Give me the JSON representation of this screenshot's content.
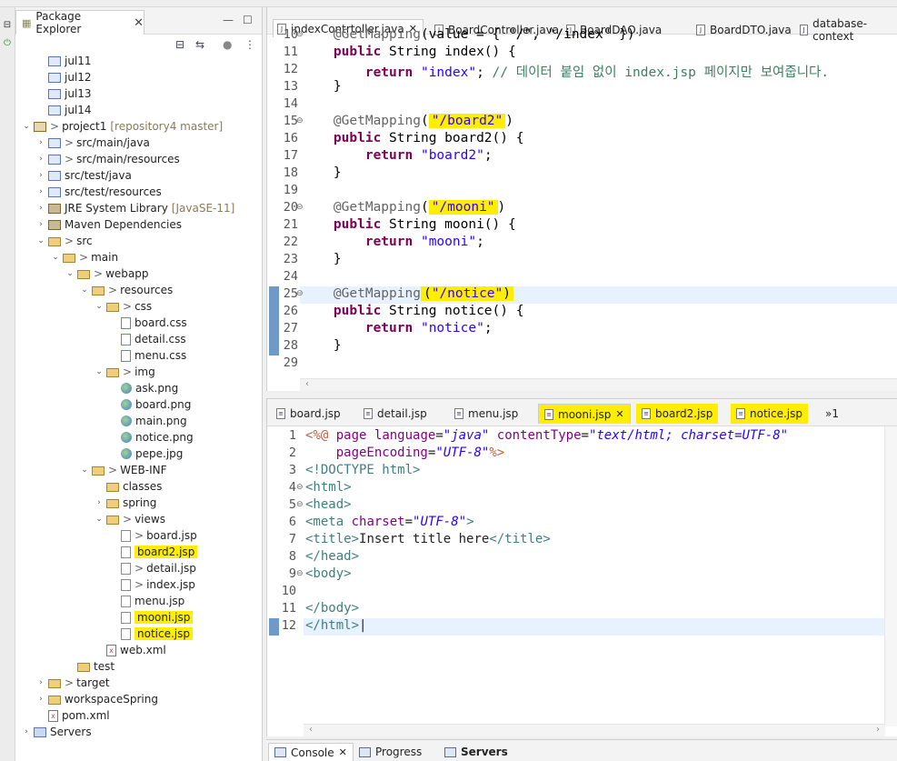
{
  "explorer": {
    "tab_label": "Package Explorer",
    "items": [
      {
        "label": "jul11",
        "indent": 1,
        "icon": "package-icon"
      },
      {
        "label": "jul12",
        "indent": 1,
        "icon": "package-icon"
      },
      {
        "label": "jul13",
        "indent": 1,
        "icon": "package-icon"
      },
      {
        "label": "jul14",
        "indent": 1,
        "icon": "package-icon"
      },
      {
        "label": "project1",
        "prefix": ">",
        "suffix": "[repository4 master]",
        "indent": 0,
        "twisty": "down",
        "icon": "project-icon"
      },
      {
        "label": "src/main/java",
        "prefix": ">",
        "indent": 1,
        "twisty": "right",
        "icon": "source-folder-icon"
      },
      {
        "label": "src/main/resources",
        "prefix": ">",
        "indent": 1,
        "twisty": "right",
        "icon": "source-folder-icon"
      },
      {
        "label": "src/test/java",
        "indent": 1,
        "twisty": "right",
        "icon": "source-folder-icon"
      },
      {
        "label": "src/test/resources",
        "indent": 1,
        "twisty": "right",
        "icon": "source-folder-icon"
      },
      {
        "label": "JRE System Library",
        "suffix": "[JavaSE-11]",
        "indent": 1,
        "twisty": "right",
        "icon": "library-icon"
      },
      {
        "label": "Maven Dependencies",
        "indent": 1,
        "twisty": "right",
        "icon": "library-icon"
      },
      {
        "label": "src",
        "prefix": ">",
        "indent": 1,
        "twisty": "down",
        "icon": "folder-icon"
      },
      {
        "label": "main",
        "prefix": ">",
        "indent": 2,
        "twisty": "down",
        "icon": "folder-icon"
      },
      {
        "label": "webapp",
        "prefix": ">",
        "indent": 3,
        "twisty": "down",
        "icon": "folder-icon"
      },
      {
        "label": "resources",
        "prefix": ">",
        "indent": 4,
        "twisty": "down",
        "icon": "folder-icon"
      },
      {
        "label": "css",
        "prefix": ">",
        "indent": 5,
        "twisty": "down",
        "icon": "folder-icon"
      },
      {
        "label": "board.css",
        "indent": 6,
        "icon": "css-file-icon"
      },
      {
        "label": "detail.css",
        "indent": 6,
        "icon": "css-file-icon"
      },
      {
        "label": "menu.css",
        "indent": 6,
        "icon": "css-file-icon"
      },
      {
        "label": "img",
        "prefix": ">",
        "indent": 5,
        "twisty": "down",
        "icon": "folder-icon"
      },
      {
        "label": "ask.png",
        "indent": 6,
        "icon": "image-file-icon"
      },
      {
        "label": "board.png",
        "indent": 6,
        "icon": "image-file-icon"
      },
      {
        "label": "main.png",
        "indent": 6,
        "icon": "image-file-icon"
      },
      {
        "label": "notice.png",
        "indent": 6,
        "icon": "image-file-icon"
      },
      {
        "label": "pepe.jpg",
        "indent": 6,
        "icon": "image-file-icon"
      },
      {
        "label": "WEB-INF",
        "prefix": ">",
        "indent": 4,
        "twisty": "down",
        "icon": "folder-icon"
      },
      {
        "label": "classes",
        "indent": 5,
        "icon": "folder-icon"
      },
      {
        "label": "spring",
        "indent": 5,
        "twisty": "right",
        "icon": "folder-icon"
      },
      {
        "label": "views",
        "prefix": ">",
        "indent": 5,
        "twisty": "down",
        "icon": "folder-icon"
      },
      {
        "label": "board.jsp",
        "prefix": ">",
        "indent": 6,
        "icon": "jsp-file-icon"
      },
      {
        "label": "board2.jsp",
        "indent": 6,
        "icon": "jsp-file-icon",
        "highlight": true
      },
      {
        "label": "detail.jsp",
        "prefix": ">",
        "indent": 6,
        "icon": "jsp-file-icon"
      },
      {
        "label": "index.jsp",
        "prefix": ">",
        "indent": 6,
        "icon": "jsp-file-icon"
      },
      {
        "label": "menu.jsp",
        "indent": 6,
        "icon": "jsp-file-icon"
      },
      {
        "label": "mooni.jsp",
        "indent": 6,
        "icon": "jsp-file-icon",
        "highlight": true
      },
      {
        "label": "notice.jsp",
        "indent": 6,
        "icon": "jsp-file-icon",
        "highlight": true
      },
      {
        "label": "web.xml",
        "indent": 5,
        "icon": "xml-file-icon"
      },
      {
        "label": "test",
        "indent": 3,
        "icon": "folder-icon"
      },
      {
        "label": "target",
        "prefix": ">",
        "indent": 1,
        "twisty": "right",
        "icon": "folder-icon"
      },
      {
        "label": "workspaceSpring",
        "indent": 1,
        "twisty": "right",
        "icon": "folder-icon"
      },
      {
        "label": "pom.xml",
        "indent": 1,
        "icon": "xml-file-icon"
      },
      {
        "label": "Servers",
        "indent": 0,
        "twisty": "right",
        "icon": "servers-folder-icon"
      }
    ]
  },
  "editor": {
    "tabs": [
      {
        "label": "indexContrtoller.java",
        "active": true
      },
      {
        "label": "BoardController.java"
      },
      {
        "label": "BoardDAO.java"
      },
      {
        "label": "BoardDTO.java"
      },
      {
        "label": "database-context"
      }
    ],
    "lines": [
      {
        "n": "10",
        "fold": true,
        "html": "    <span class='ann'>@GetMapping</span>(value = { \"/\", \"/index\" })"
      },
      {
        "n": "11",
        "html": "    <span class='kw'>public</span> String index() {"
      },
      {
        "n": "12",
        "html": "        <span class='kw'>return</span> <span class='str'>\"index\"</span>; <span class='cmt'>// 데이터 붙임 없이 index.jsp 페이지만 보여줍니다.</span>"
      },
      {
        "n": "13",
        "html": "    }"
      },
      {
        "n": "14",
        "html": ""
      },
      {
        "n": "15",
        "fold": true,
        "html": "    <span class='ann'>@GetMapping</span>(<span class='hl'><span class='str'>\"/board2\"</span></span>)"
      },
      {
        "n": "16",
        "html": "    <span class='kw'>public</span> String board2() {"
      },
      {
        "n": "17",
        "html": "        <span class='kw'>return</span> <span class='str'>\"board2\"</span>;"
      },
      {
        "n": "18",
        "html": "    }"
      },
      {
        "n": "19",
        "html": ""
      },
      {
        "n": "20",
        "fold": true,
        "html": "    <span class='ann'>@GetMapping</span>(<span class='hl'><span class='str'>\"/mooni\"</span></span>)"
      },
      {
        "n": "21",
        "html": "    <span class='kw'>public</span> String mooni() {"
      },
      {
        "n": "22",
        "html": "        <span class='kw'>return</span> <span class='str'>\"mooni\"</span>;"
      },
      {
        "n": "23",
        "html": "    }"
      },
      {
        "n": "24",
        "html": ""
      },
      {
        "n": "25",
        "fold": true,
        "mark": true,
        "cur": true,
        "html": "    <span class='ann'>@GetMapping</span><span class='hl'>(<span class='str'>\"/notice\"</span>)</span>"
      },
      {
        "n": "26",
        "mark": true,
        "html": "    <span class='kw'>public</span> String notice() {"
      },
      {
        "n": "27",
        "mark": true,
        "html": "        <span class='kw'>return</span> <span class='str'>\"notice\"</span>;"
      },
      {
        "n": "28",
        "mark": true,
        "html": "    }"
      },
      {
        "n": "29",
        "html": ""
      }
    ]
  },
  "jsp_editor": {
    "tabs": [
      {
        "label": "board.jsp"
      },
      {
        "label": "detail.jsp"
      },
      {
        "label": "menu.jsp"
      },
      {
        "label": "mooni.jsp",
        "active": true,
        "highlight": true
      },
      {
        "label": "board2.jsp",
        "highlight": true
      },
      {
        "label": "notice.jsp",
        "highlight": true
      }
    ],
    "overflow_label": "»1",
    "lines": [
      {
        "n": "1",
        "html": "<span class='jsp-dir'>&lt;%@</span> <span class='attr'>page</span> <span class='attr'>language</span>=<span class='aval'>\"java\"</span> <span class='attr'>contentType</span>=<span class='aval'>\"text/html; charset=UTF-8\"</span>"
      },
      {
        "n": "2",
        "html": "    <span class='attr'>pageEncoding</span>=<span class='aval'>\"UTF-8\"</span><span class='jsp-dir'>%&gt;</span>"
      },
      {
        "n": "3",
        "html": "<span class='tag'>&lt;!DOCTYPE html&gt;</span>"
      },
      {
        "n": "4",
        "fold": true,
        "html": "<span class='tag'>&lt;html&gt;</span>"
      },
      {
        "n": "5",
        "fold": true,
        "html": "<span class='tag'>&lt;head&gt;</span>"
      },
      {
        "n": "6",
        "html": "<span class='tag'>&lt;meta</span> <span class='attr'>charset</span>=<span class='aval'>\"UTF-8\"</span><span class='tag'>&gt;</span>"
      },
      {
        "n": "7",
        "html": "<span class='tag'>&lt;title&gt;</span>Insert title here<span class='tag'>&lt;/title&gt;</span>"
      },
      {
        "n": "8",
        "html": "<span class='tag'>&lt;/head&gt;</span>"
      },
      {
        "n": "9",
        "fold": true,
        "html": "<span class='tag'>&lt;body&gt;</span>"
      },
      {
        "n": "10",
        "html": ""
      },
      {
        "n": "11",
        "html": "<span class='tag'>&lt;/body&gt;</span>"
      },
      {
        "n": "12",
        "mark": true,
        "cur": true,
        "html": "<span class='tag'>&lt;/html&gt;</span>|"
      }
    ]
  },
  "bottom": {
    "tabs": [
      {
        "label": "Console",
        "active": true,
        "closable": true
      },
      {
        "label": "Progress"
      },
      {
        "label": "Servers",
        "bold": true
      }
    ]
  }
}
